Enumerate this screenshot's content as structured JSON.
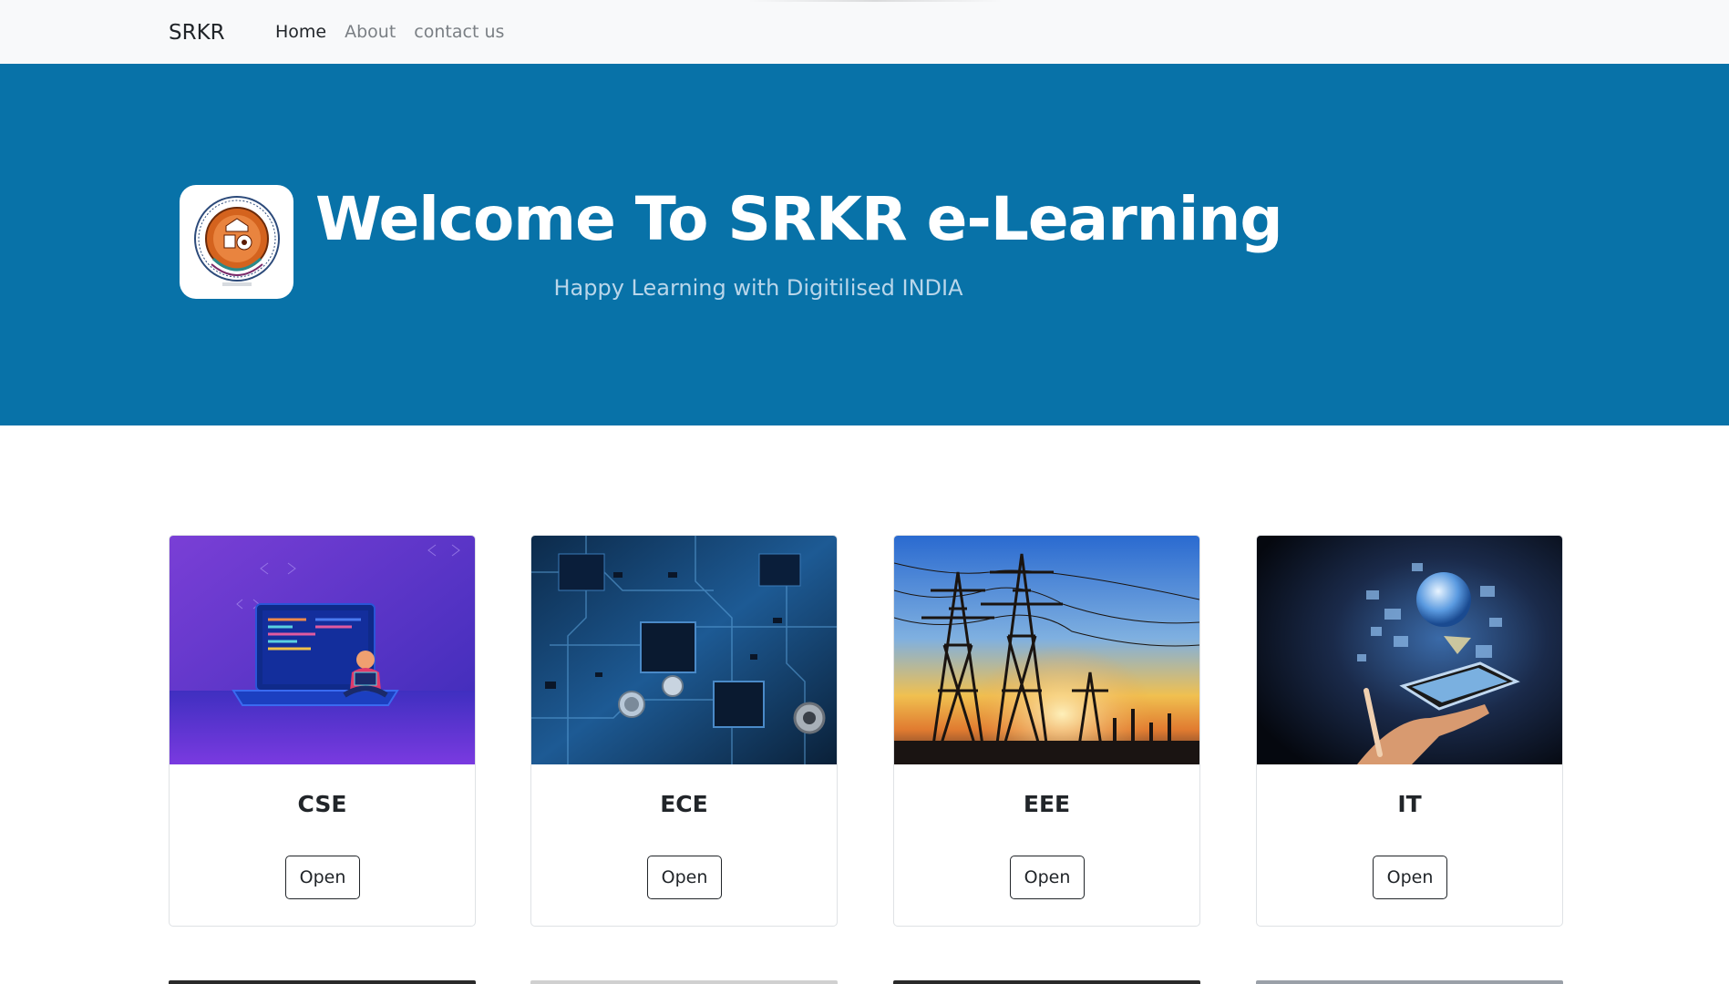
{
  "navbar": {
    "brand": "SRKR",
    "links": [
      {
        "label": "Home",
        "active": true
      },
      {
        "label": "About",
        "active": false
      },
      {
        "label": "contact us",
        "active": false
      }
    ]
  },
  "hero": {
    "title": "Welcome To SRKR e-Learning",
    "subtitle": "Happy Learning with Digitilised INDIA",
    "background_color": "#0872a8"
  },
  "departments": [
    {
      "name": "CSE",
      "button_label": "Open",
      "image": "laptop-coder-illustration"
    },
    {
      "name": "ECE",
      "button_label": "Open",
      "image": "circuit-board-photo"
    },
    {
      "name": "EEE",
      "button_label": "Open",
      "image": "power-pylons-sunset-photo"
    },
    {
      "name": "IT",
      "button_label": "Open",
      "image": "hand-globe-tablet-photo"
    }
  ]
}
